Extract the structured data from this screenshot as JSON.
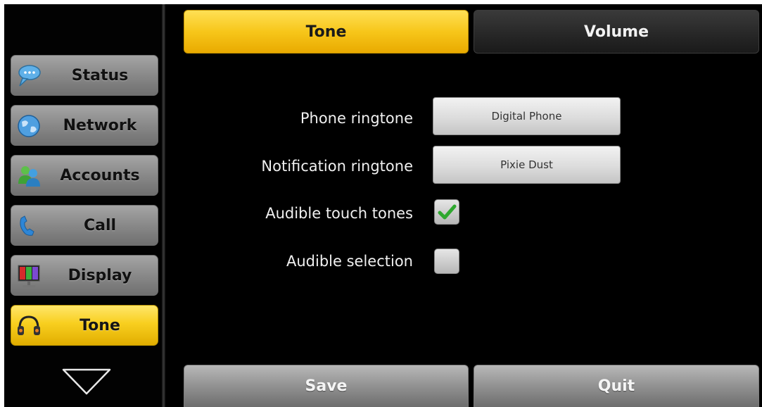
{
  "sidebar": {
    "items": [
      {
        "label": "Status",
        "icon": "status-chat-icon",
        "active": false
      },
      {
        "label": "Network",
        "icon": "network-globe-icon",
        "active": false
      },
      {
        "label": "Accounts",
        "icon": "accounts-people-icon",
        "active": false
      },
      {
        "label": "Call",
        "icon": "call-handset-icon",
        "active": false
      },
      {
        "label": "Display",
        "icon": "display-monitor-icon",
        "active": false
      },
      {
        "label": "Tone",
        "icon": "tone-headset-icon",
        "active": true
      }
    ],
    "scroll_down_icon": "triangle-down-icon"
  },
  "tabs": [
    {
      "label": "Tone",
      "active": true
    },
    {
      "label": "Volume",
      "active": false
    }
  ],
  "settings": {
    "phone_ringtone": {
      "label": "Phone ringtone",
      "value": "Digital Phone"
    },
    "notification_ringtone": {
      "label": "Notification ringtone",
      "value": "Pixie Dust"
    },
    "audible_touch_tones": {
      "label": "Audible touch tones",
      "checked": true
    },
    "audible_selection": {
      "label": "Audible selection",
      "checked": false
    }
  },
  "buttons": {
    "save": "Save",
    "quit": "Quit"
  },
  "colors": {
    "accent_yellow": "#f7c61a",
    "background": "#000000",
    "check_green": "#2fa82f"
  }
}
